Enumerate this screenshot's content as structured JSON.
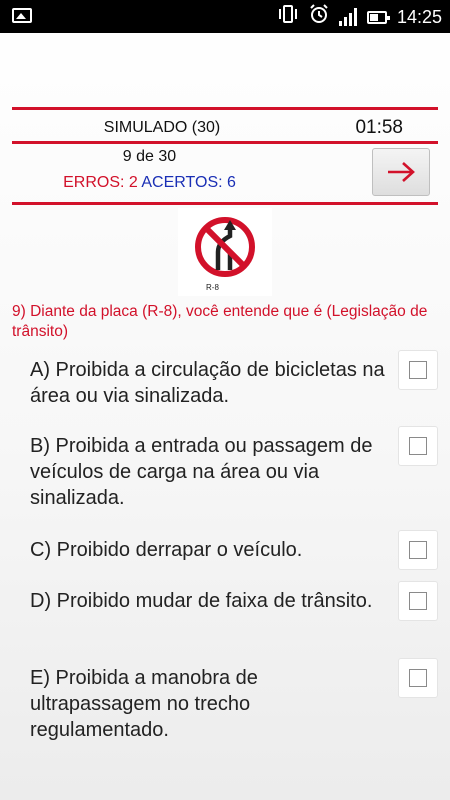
{
  "status_bar": {
    "time": "14:25",
    "icons": [
      "image-icon",
      "vibrate-icon",
      "alarm-icon",
      "signal-icon",
      "battery-icon"
    ]
  },
  "quiz": {
    "title": "SIMULADO (30)",
    "timer": "01:58",
    "counter": "9 de 30",
    "errors_label": "ERROS: 2",
    "hits_label": "ACERTOS: 6",
    "sign_code": "R-8",
    "question": "9) Diante da placa (R-8), você entende que é (Legislação de trânsito)",
    "options": [
      {
        "label": "A) Proibida a circulação de bicicletas na área ou via sinalizada.",
        "checked": false
      },
      {
        "label": "B) Proibida a entrada ou passagem de veículos de carga na área ou via sinalizada.",
        "checked": false
      },
      {
        "label": "C) Proibido derrapar o veículo.",
        "checked": false
      },
      {
        "label": "D) Proibido mudar de faixa de trânsito.",
        "checked": false
      },
      {
        "label": "E) Proibida a manobra de ultrapassagem no trecho regulamentado.",
        "checked": false
      }
    ]
  },
  "colors": {
    "accent_red": "#d2112a",
    "accent_blue": "#1a2fb5"
  }
}
